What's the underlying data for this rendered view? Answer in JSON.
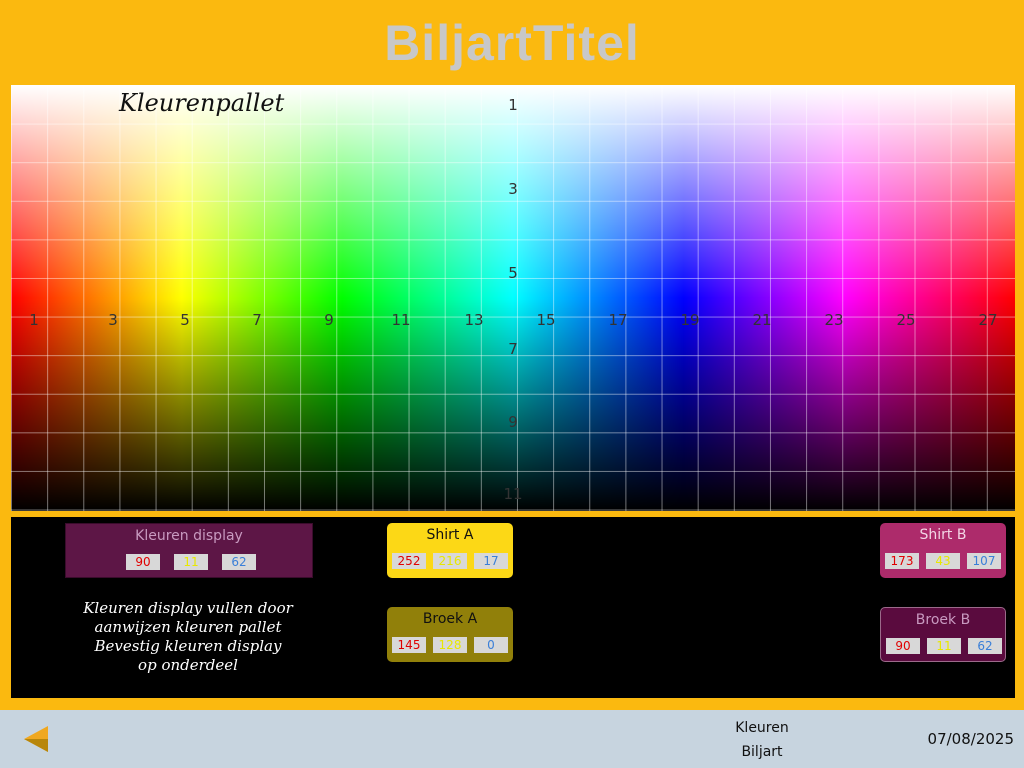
{
  "app": {
    "title": "BiljartTitel"
  },
  "palette": {
    "heading": "Kleurenpallet",
    "row_numbers": [
      "1",
      "3",
      "5",
      "7",
      "9",
      "11"
    ],
    "column_numbers": [
      "1",
      "3",
      "5",
      "7",
      "9",
      "11",
      "13",
      "15",
      "17",
      "19",
      "21",
      "23",
      "25",
      "27"
    ]
  },
  "display": {
    "label": "Kleuren display",
    "r": "90",
    "g": "11",
    "b": "62",
    "instructions": [
      "Kleuren display vullen door",
      "aanwijzen kleuren pallet",
      "Bevestig kleuren display",
      "op onderdeel"
    ]
  },
  "parts": {
    "shirt_a": {
      "label": "Shirt A",
      "r": "252",
      "g": "216",
      "b": "17",
      "color": "#fcd816"
    },
    "broek_a": {
      "label": "Broek A",
      "r": "145",
      "g": "128",
      "b": "0",
      "color": "#91800a"
    },
    "shirt_b": {
      "label": "Shirt B",
      "r": "173",
      "g": "43",
      "b": "107",
      "color": "#ad2b6b"
    },
    "broek_b": {
      "label": "Broek B",
      "r": "90",
      "g": "11",
      "b": "62",
      "color": "#5a0b3e"
    }
  },
  "footer": {
    "back_icon": "back-arrow-icon",
    "line1": "Kleuren",
    "line2": "Biljart",
    "date": "07/08/2025"
  },
  "colors": {
    "background": "#fbb90f",
    "footer": "#c7d4df",
    "panel": "#000000"
  }
}
